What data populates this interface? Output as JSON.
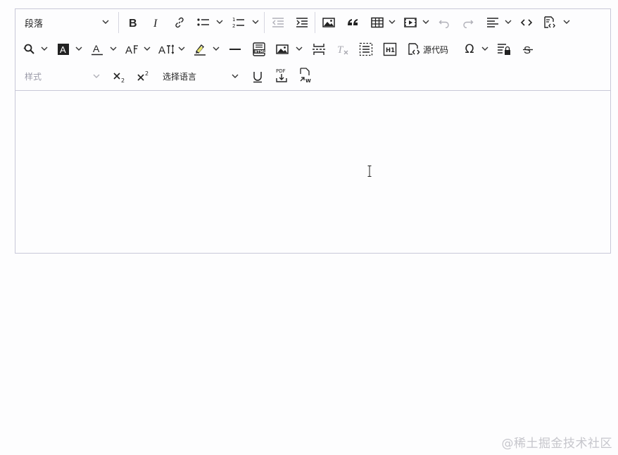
{
  "toolbar": {
    "heading_select": "段落",
    "style_select": "样式",
    "language_select": "选择语言",
    "source_code_label": "源代码",
    "omega_label": "Ω"
  },
  "icons": [
    "bold-icon",
    "italic-icon",
    "link-icon",
    "bulleted-list-icon",
    "numbered-list-icon",
    "outdent-icon",
    "indent-icon",
    "image-icon",
    "blockquote-icon",
    "table-icon",
    "media-icon",
    "undo-icon",
    "redo-icon",
    "align-icon",
    "code-icon",
    "code-block-icon",
    "find-replace-icon",
    "font-background-color-icon",
    "font-color-icon",
    "font-family-icon",
    "font-size-icon",
    "highlight-icon",
    "horizontal-line-icon",
    "html-embed-icon",
    "insert-image-icon",
    "page-break-icon",
    "remove-format-icon",
    "select-all-icon",
    "heading1-icon",
    "source-code-icon",
    "special-characters-icon",
    "restricted-editing-icon",
    "strikethrough-icon",
    "subscript-icon",
    "superscript-icon",
    "underline-icon",
    "export-pdf-icon",
    "export-word-icon"
  ],
  "watermark": "@稀土掘金技术社区"
}
